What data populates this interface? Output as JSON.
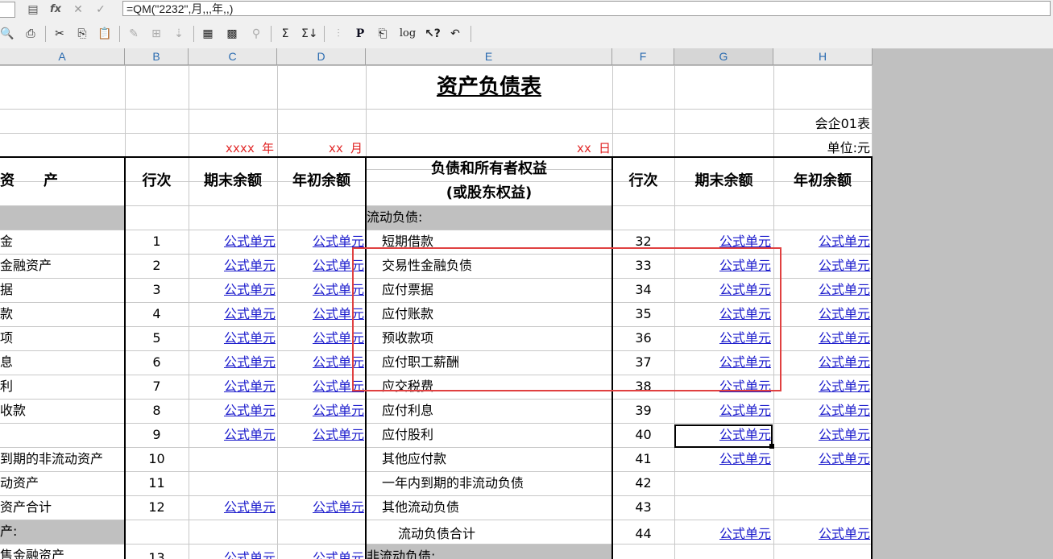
{
  "formula_bar": {
    "formula": "=QM(\"2232\",月,,,年,,)"
  },
  "toolbar": {
    "p_label": "P",
    "log_label": "log"
  },
  "columns": [
    "A",
    "B",
    "C",
    "D",
    "E",
    "F",
    "G",
    "H"
  ],
  "sheet": {
    "title": "资产负债表",
    "form_no": "会企01表",
    "unit": "单位:元",
    "year_text": "xxxx 年",
    "month_text": "xx 月",
    "day_text": "xx 日",
    "h_asset": "资　　产",
    "h_row": "行次",
    "h_end": "期末余额",
    "h_begin": "年初余额",
    "h_liab1": "负债和所有者权益",
    "h_liab2": "(或股东权益)",
    "formula_cell": "公式单元",
    "left_rows": [
      {
        "label": "",
        "num": ""
      },
      {
        "label": "金",
        "num": "1"
      },
      {
        "label": "金融资产",
        "num": "2"
      },
      {
        "label": "据",
        "num": "3"
      },
      {
        "label": "款",
        "num": "4"
      },
      {
        "label": "项",
        "num": "5"
      },
      {
        "label": "息",
        "num": "6"
      },
      {
        "label": "利",
        "num": "7"
      },
      {
        "label": "收款",
        "num": "8"
      },
      {
        "label": "",
        "num": "9"
      },
      {
        "label": "到期的非流动资产",
        "num": "10"
      },
      {
        "label": "动资产",
        "num": "11"
      },
      {
        "label": "资产合计",
        "num": "12"
      },
      {
        "label": "产:",
        "num": ""
      },
      {
        "label": "售金融资产",
        "num": "13"
      }
    ],
    "right_rows": [
      {
        "label": "流动负债:",
        "num": ""
      },
      {
        "label": "短期借款",
        "num": "32"
      },
      {
        "label": "交易性金融负债",
        "num": "33"
      },
      {
        "label": "应付票据",
        "num": "34"
      },
      {
        "label": "应付账款",
        "num": "35"
      },
      {
        "label": "预收款项",
        "num": "36"
      },
      {
        "label": "应付职工薪酬",
        "num": "37"
      },
      {
        "label": "应交税费",
        "num": "38"
      },
      {
        "label": "应付利息",
        "num": "39"
      },
      {
        "label": "应付股利",
        "num": "40"
      },
      {
        "label": "其他应付款",
        "num": "41"
      },
      {
        "label": "一年内到期的非流动负债",
        "num": "42"
      },
      {
        "label": "其他流动负债",
        "num": "43"
      },
      {
        "label": "流动负债合计",
        "num": "44"
      },
      {
        "label": "非流动负债:",
        "num": ""
      }
    ]
  }
}
